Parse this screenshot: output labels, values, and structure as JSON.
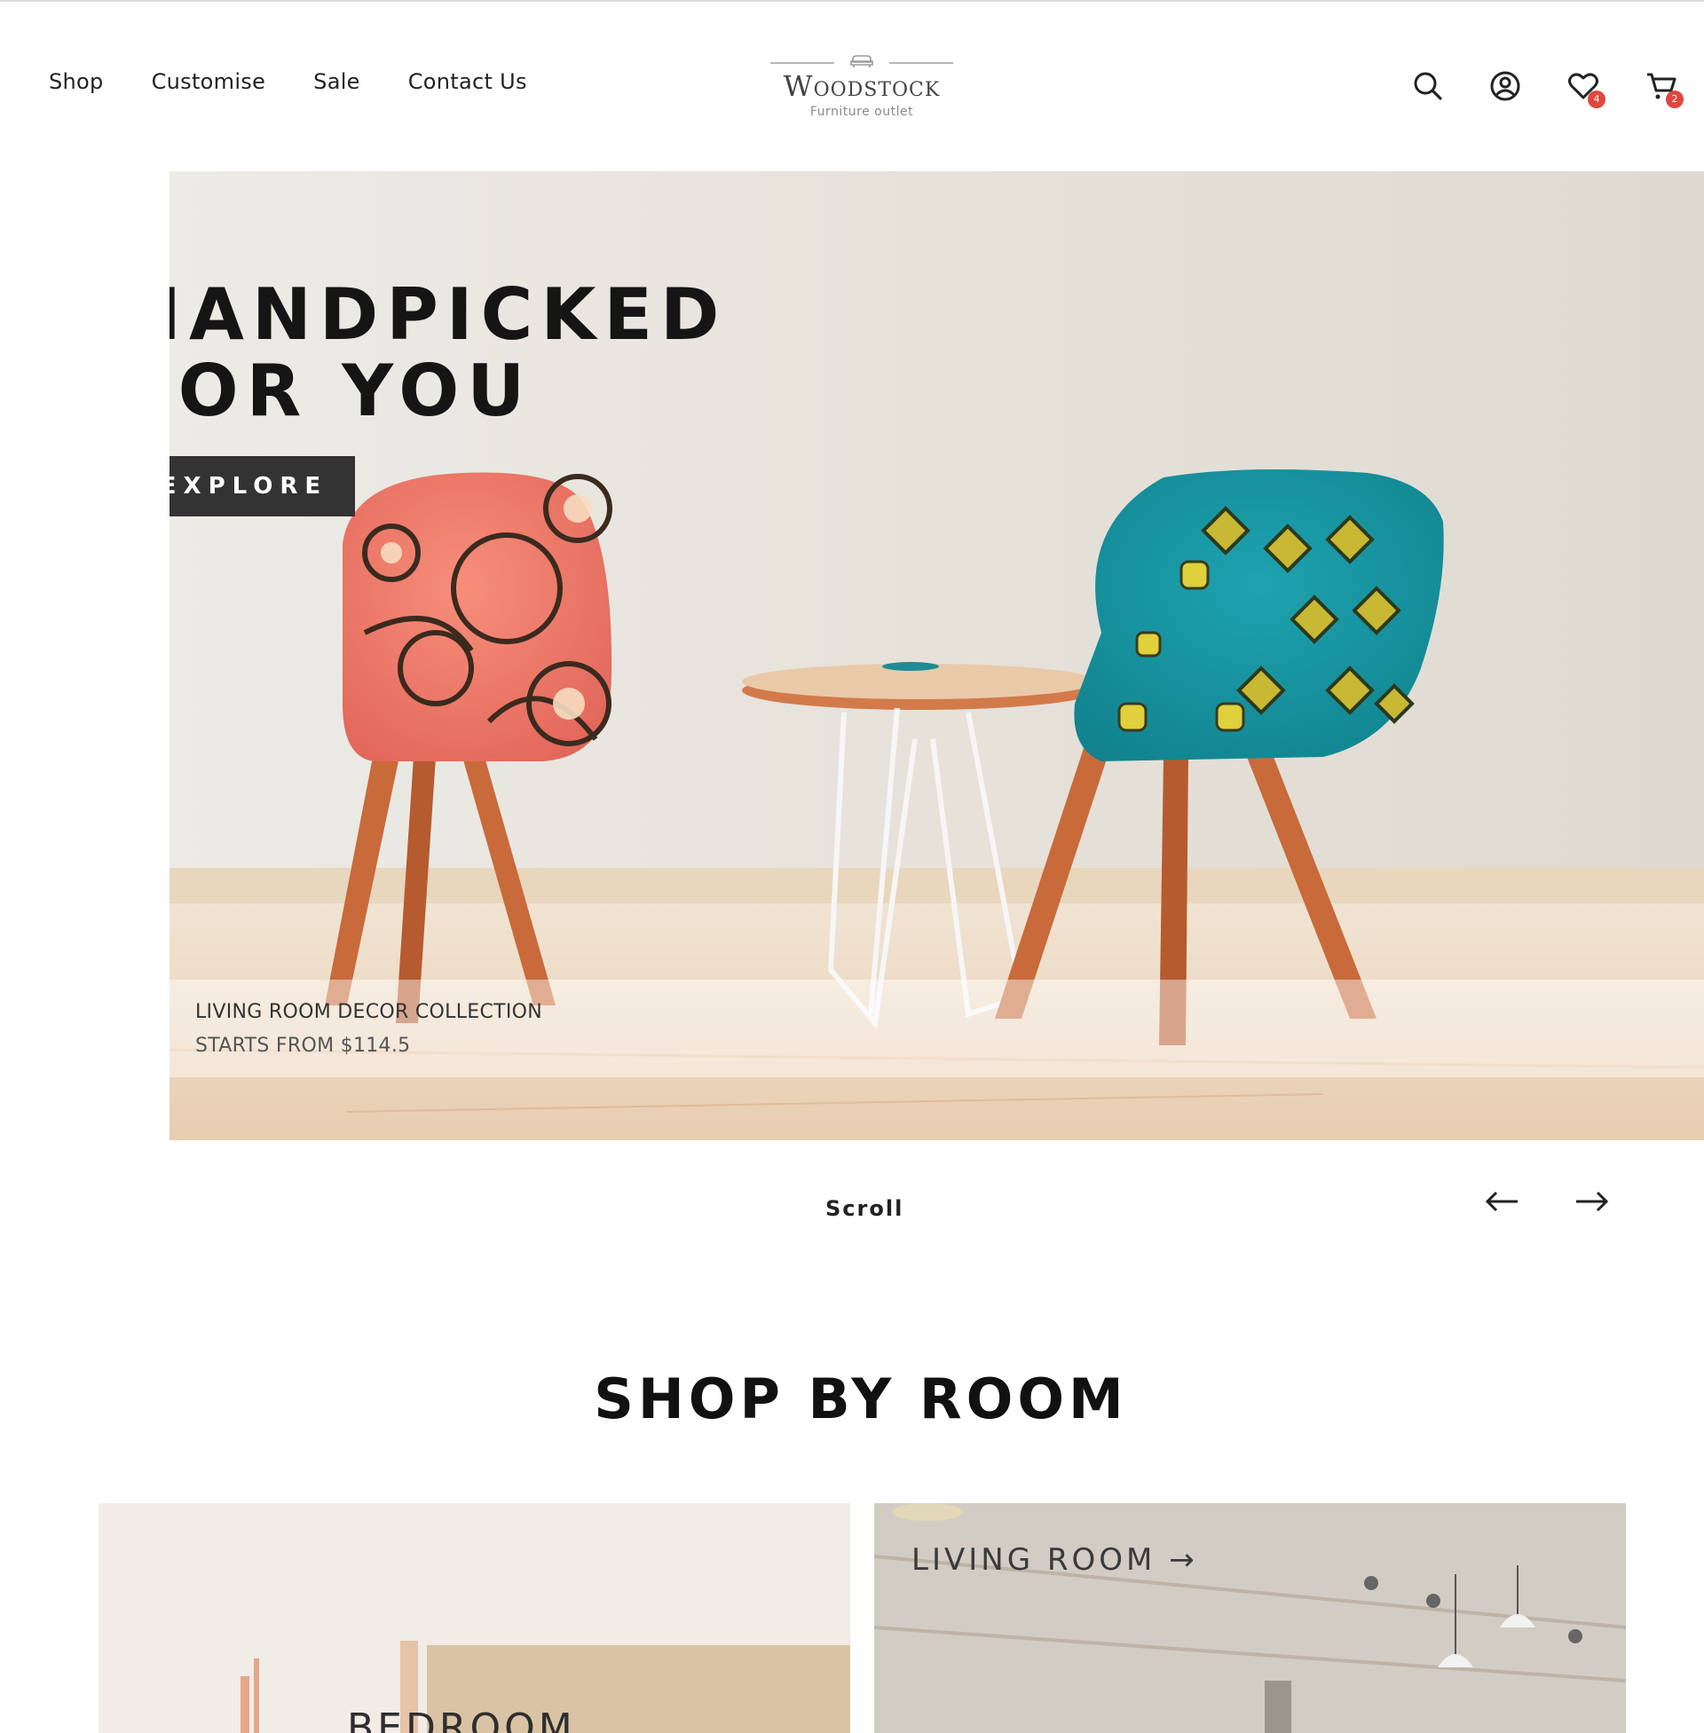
{
  "nav": {
    "items": [
      {
        "label": "Shop"
      },
      {
        "label": "Customise"
      },
      {
        "label": "Sale"
      },
      {
        "label": "Contact Us"
      }
    ]
  },
  "logo": {
    "name": "Woodstock",
    "tagline": "Furniture outlet"
  },
  "header_icons": {
    "search": "search-icon",
    "account": "user-circle-icon",
    "wishlist": {
      "icon": "heart-icon",
      "count": "4"
    },
    "cart": {
      "icon": "cart-icon",
      "count": "2"
    }
  },
  "hero": {
    "title_line1": "HANDPICKED",
    "title_line2": "FOR YOU",
    "cta_label": "EXPLORE",
    "caption_line1": "LIVING ROOM DECOR COLLECTION",
    "caption_line2": "STARTS FROM $114.5"
  },
  "carousel": {
    "scroll_label": "Scroll",
    "prev_icon": "arrow-left-icon",
    "next_icon": "arrow-right-icon"
  },
  "shop_by_room": {
    "title": "SHOP BY ROOM",
    "rooms": [
      {
        "label": "BEDROOM"
      },
      {
        "label": "LIVING ROOM →"
      }
    ]
  },
  "colors": {
    "badge": "#e0473e",
    "button_bg": "#333333",
    "text": "#1b1b1b"
  }
}
